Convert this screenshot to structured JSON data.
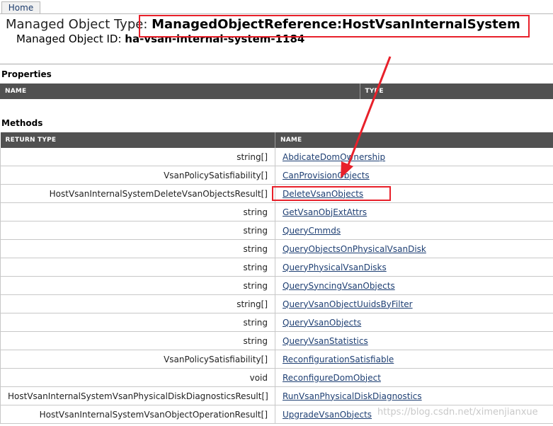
{
  "nav": {
    "home_label": "Home"
  },
  "header": {
    "type_label": "Managed Object Type: ",
    "type_value": "ManagedObjectReference:HostVsanInternalSystem",
    "id_label": "Managed Object ID: ",
    "id_value": "ha-vsan-internal-system-1184"
  },
  "properties": {
    "title": "Properties",
    "col_name": "NAME",
    "col_type": "TYPE"
  },
  "methods": {
    "title": "Methods",
    "col_return": "RETURN TYPE",
    "col_name": "NAME",
    "rows": [
      {
        "ret": "string[]",
        "name": "AbdicateDomOwnership"
      },
      {
        "ret": "VsanPolicySatisfiability[]",
        "name": "CanProvisionObjects"
      },
      {
        "ret": "HostVsanInternalSystemDeleteVsanObjectsResult[]",
        "name": "DeleteVsanObjects"
      },
      {
        "ret": "string",
        "name": "GetVsanObjExtAttrs"
      },
      {
        "ret": "string",
        "name": "QueryCmmds"
      },
      {
        "ret": "string",
        "name": "QueryObjectsOnPhysicalVsanDisk"
      },
      {
        "ret": "string",
        "name": "QueryPhysicalVsanDisks"
      },
      {
        "ret": "string",
        "name": "QuerySyncingVsanObjects"
      },
      {
        "ret": "string[]",
        "name": "QueryVsanObjectUuidsByFilter"
      },
      {
        "ret": "string",
        "name": "QueryVsanObjects"
      },
      {
        "ret": "string",
        "name": "QueryVsanStatistics"
      },
      {
        "ret": "VsanPolicySatisfiability[]",
        "name": "ReconfigurationSatisfiable"
      },
      {
        "ret": "void",
        "name": "ReconfigureDomObject"
      },
      {
        "ret": "HostVsanInternalSystemVsanPhysicalDiskDiagnosticsResult[]",
        "name": "RunVsanPhysicalDiskDiagnostics"
      },
      {
        "ret": "HostVsanInternalSystemVsanObjectOperationResult[]",
        "name": "UpgradeVsanObjects"
      }
    ]
  },
  "watermark": "https://blog.csdn.net/ximenjianxue",
  "annotation_color": "#e8202a"
}
